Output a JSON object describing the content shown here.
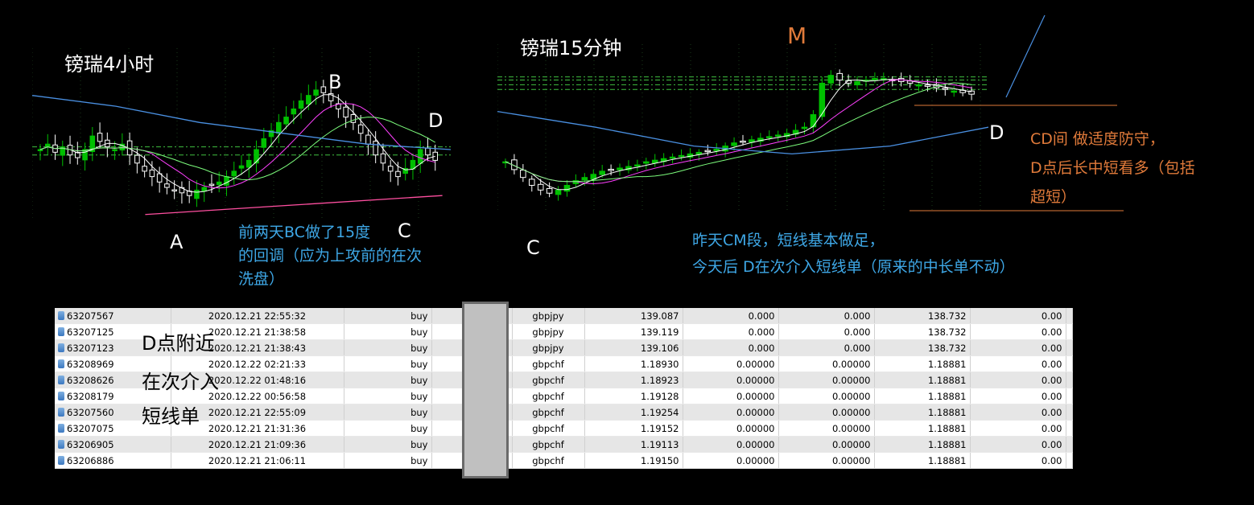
{
  "left_panel": {
    "title": "镑瑞4小时",
    "point_a": "A",
    "point_b": "B",
    "point_c": "C",
    "point_d": "D",
    "note_line1": "前两天BC做了15度",
    "note_line2": "的回调（应为上攻前的在次",
    "note_line3": "洗盘）"
  },
  "right_panel": {
    "title": "镑瑞15分钟",
    "point_m": "M",
    "point_c": "C",
    "point_d": "D",
    "note_line1": "昨天CM段，短线基本做足，",
    "note_line2": "今天后 D在次介入短线单（原来的中长单不动）",
    "strategy_line1": "CD间 做适度防守，",
    "strategy_line2": "D点后长中短看多（包括",
    "strategy_line3": "超短）"
  },
  "overlay_note": {
    "line1": "D点附近",
    "line2": "在次介入",
    "line3": "短线单"
  },
  "colors": {
    "bull_candle": "#00c000",
    "bear_candle": "#ffffff",
    "ma_white": "#ffffff",
    "ma_magenta": "#ff40ff",
    "ma_green": "#7cfc7c",
    "ma_blue": "#4a90e2",
    "trendline_pink": "#ff4fa0",
    "orange_line": "#e07a3a",
    "level_lines": "#40c040"
  },
  "orders": [
    {
      "ticket": "63207567",
      "time": "2020.12.21 22:55:32",
      "type": "buy",
      "symbol": "gbpjpy",
      "price": "139.087",
      "sl": "0.000",
      "tp": "0.000",
      "cur": "138.732",
      "profit": "0.00"
    },
    {
      "ticket": "63207125",
      "time": "2020.12.21 21:38:58",
      "type": "buy",
      "symbol": "gbpjpy",
      "price": "139.119",
      "sl": "0.000",
      "tp": "0.000",
      "cur": "138.732",
      "profit": "0.00"
    },
    {
      "ticket": "63207123",
      "time": "2020.12.21 21:38:43",
      "type": "buy",
      "symbol": "gbpjpy",
      "price": "139.106",
      "sl": "0.000",
      "tp": "0.000",
      "cur": "138.732",
      "profit": "0.00"
    },
    {
      "ticket": "63208969",
      "time": "2020.12.22 02:21:33",
      "type": "buy",
      "symbol": "gbpchf",
      "price": "1.18930",
      "sl": "0.00000",
      "tp": "0.00000",
      "cur": "1.18881",
      "profit": "0.00"
    },
    {
      "ticket": "63208626",
      "time": "2020.12.22 01:48:16",
      "type": "buy",
      "symbol": "gbpchf",
      "price": "1.18923",
      "sl": "0.00000",
      "tp": "0.00000",
      "cur": "1.18881",
      "profit": "0.00"
    },
    {
      "ticket": "63208179",
      "time": "2020.12.22 00:56:58",
      "type": "buy",
      "symbol": "gbpchf",
      "price": "1.19128",
      "sl": "0.00000",
      "tp": "0.00000",
      "cur": "1.18881",
      "profit": "0.00"
    },
    {
      "ticket": "63207560",
      "time": "2020.12.21 22:55:09",
      "type": "buy",
      "symbol": "gbpchf",
      "price": "1.19254",
      "sl": "0.00000",
      "tp": "0.00000",
      "cur": "1.18881",
      "profit": "0.00"
    },
    {
      "ticket": "63207075",
      "time": "2020.12.21 21:31:36",
      "type": "buy",
      "symbol": "gbpchf",
      "price": "1.19152",
      "sl": "0.00000",
      "tp": "0.00000",
      "cur": "1.18881",
      "profit": "0.00"
    },
    {
      "ticket": "63206905",
      "time": "2020.12.21 21:09:36",
      "type": "buy",
      "symbol": "gbpchf",
      "price": "1.19113",
      "sl": "0.00000",
      "tp": "0.00000",
      "cur": "1.18881",
      "profit": "0.00"
    },
    {
      "ticket": "63206886",
      "time": "2020.12.21 21:06:11",
      "type": "buy",
      "symbol": "gbpchf",
      "price": "1.19150",
      "sl": "0.00000",
      "tp": "0.00000",
      "cur": "1.18881",
      "profit": "0.00"
    }
  ],
  "chart_data": [
    {
      "type": "candlestick",
      "title": "镑瑞4小时",
      "symbol": "gbpchf",
      "timeframe": "H4",
      "annotations": [
        "A",
        "B",
        "C",
        "D"
      ],
      "close": [
        50,
        52,
        49,
        51,
        48,
        47,
        50,
        55,
        53,
        51,
        50,
        52,
        48,
        45,
        42,
        40,
        38,
        36,
        35,
        34,
        33,
        35,
        36,
        37,
        38,
        40,
        42,
        44,
        46,
        50,
        54,
        57,
        60,
        62,
        65,
        68,
        70,
        72,
        71,
        68,
        65,
        62,
        60,
        56,
        52,
        48,
        45,
        42,
        40,
        43,
        46,
        50,
        48,
        46
      ],
      "moving_averages": [
        "white",
        "magenta",
        "green",
        "blue"
      ]
    },
    {
      "type": "candlestick",
      "title": "镑瑞15分钟",
      "symbol": "gbpchf",
      "timeframe": "M15",
      "annotations": [
        "M",
        "C",
        "D"
      ],
      "close": [
        30,
        25,
        20,
        15,
        12,
        10,
        12,
        15,
        18,
        20,
        22,
        24,
        25,
        26,
        27,
        28,
        30,
        31,
        32,
        33,
        34,
        35,
        36,
        37,
        38,
        40,
        42,
        43,
        44,
        45,
        46,
        47,
        48,
        50,
        52,
        60,
        80,
        85,
        82,
        80,
        81,
        82,
        83,
        83,
        82,
        81,
        80,
        79,
        78,
        77,
        76,
        75,
        74,
        73
      ],
      "moving_averages": [
        "white",
        "magenta",
        "green",
        "blue"
      ]
    }
  ]
}
